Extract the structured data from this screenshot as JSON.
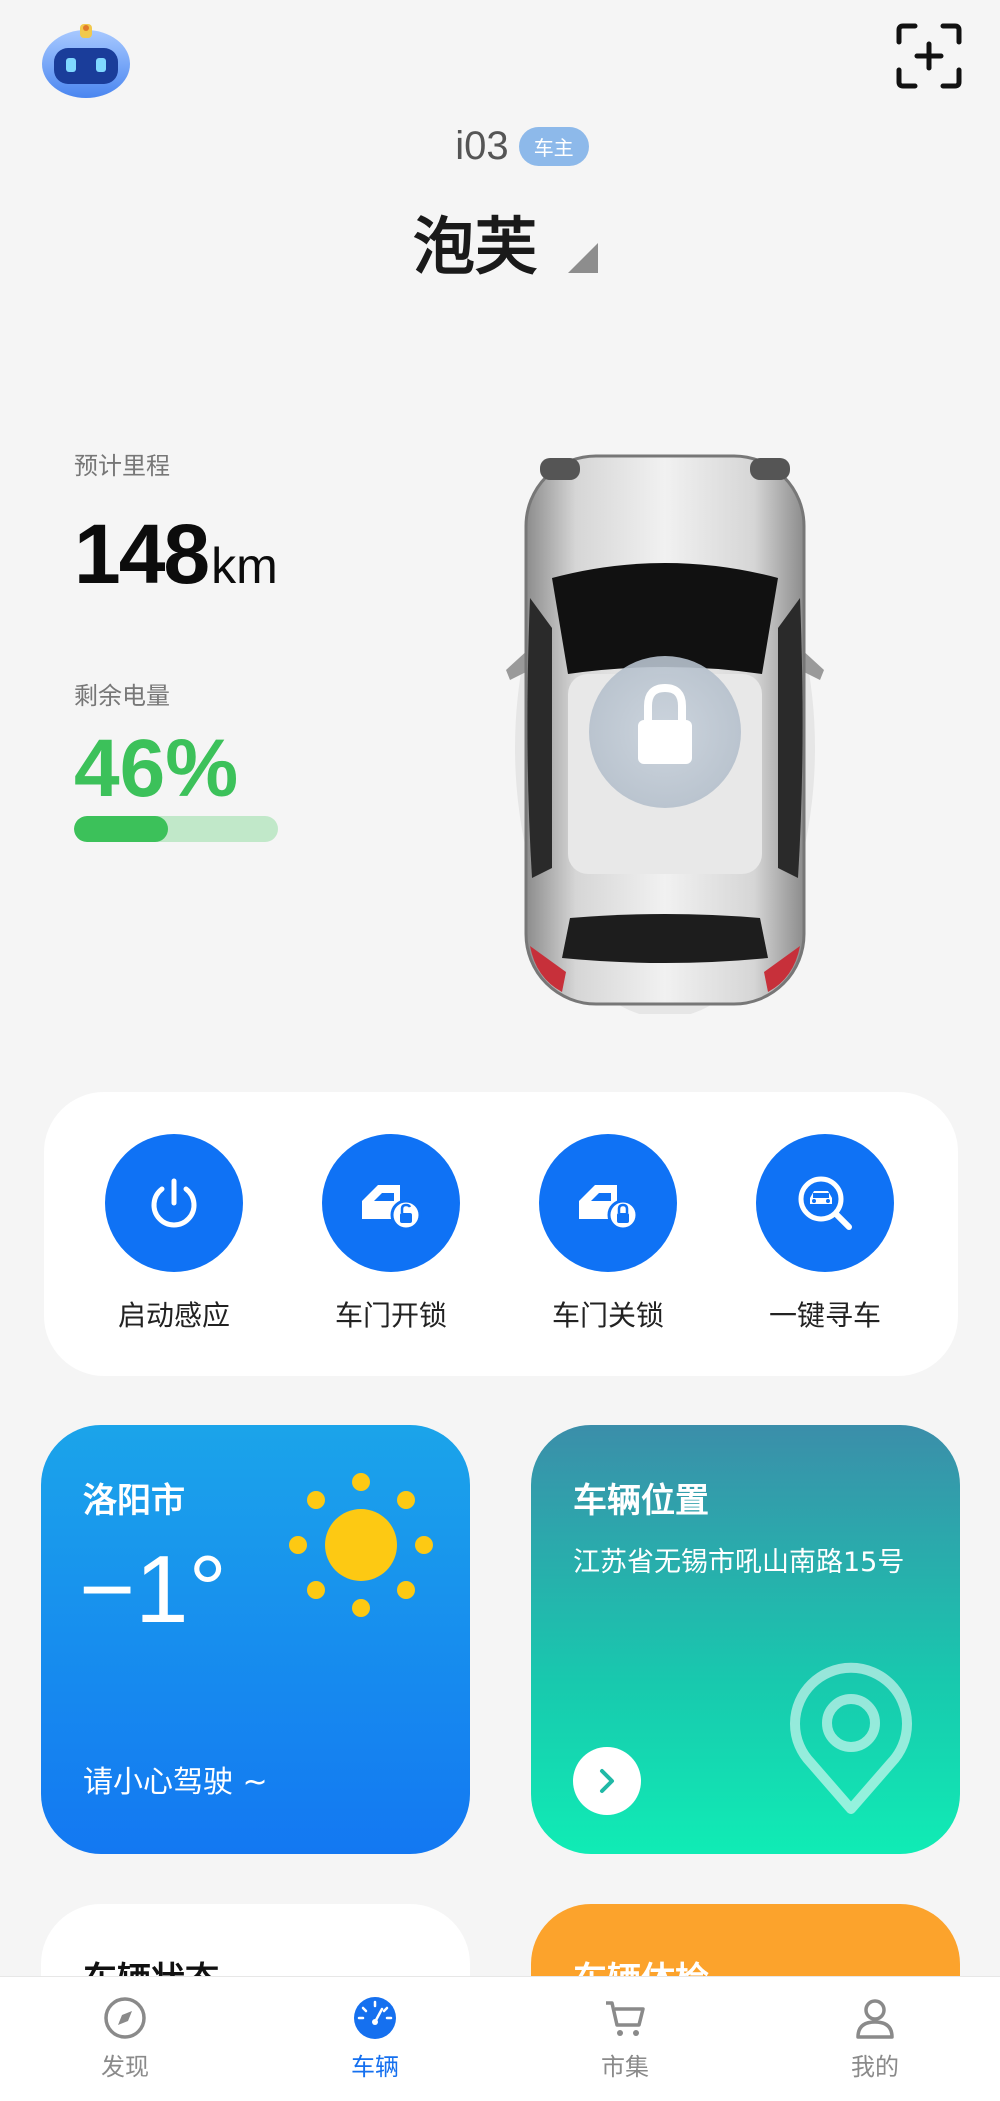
{
  "header": {
    "model": "i03",
    "owner_badge": "车主",
    "nickname": "泡芙"
  },
  "stats": {
    "range_label": "预计里程",
    "range_value": "148",
    "range_unit": "km",
    "battery_label": "剩余电量",
    "battery_value": "46%",
    "battery_fraction": 0.46
  },
  "car": {
    "lock_state": "locked"
  },
  "actions": [
    {
      "label": "启动感应",
      "icon": "power-icon"
    },
    {
      "label": "车门开锁",
      "icon": "door-unlock-icon"
    },
    {
      "label": "车门关锁",
      "icon": "door-lock-icon"
    },
    {
      "label": "一键寻车",
      "icon": "car-search-icon"
    }
  ],
  "weather": {
    "city": "洛阳市",
    "temperature": "−1°",
    "tip": "请小心驾驶 ~",
    "icon": "sun-icon"
  },
  "location": {
    "title": "车辆位置",
    "address": "江苏省无锡市吼山南路15号"
  },
  "cards": {
    "status_title": "车辆状态",
    "check_title": "车辆体检"
  },
  "nav": [
    {
      "label": "发现",
      "icon": "compass-icon",
      "active": false
    },
    {
      "label": "车辆",
      "icon": "speedometer-icon",
      "active": true
    },
    {
      "label": "市集",
      "icon": "cart-icon",
      "active": false
    },
    {
      "label": "我的",
      "icon": "person-icon",
      "active": false
    }
  ],
  "colors": {
    "accent": "#0f72f5",
    "battery": "#3cc15a",
    "nav_active": "#1570ef",
    "weather_gradient": [
      "#1ba4ea",
      "#1378f2"
    ],
    "location_gradient": [
      "#3b8eaa",
      "#10ecb5"
    ],
    "check_card": "#fca32c"
  }
}
